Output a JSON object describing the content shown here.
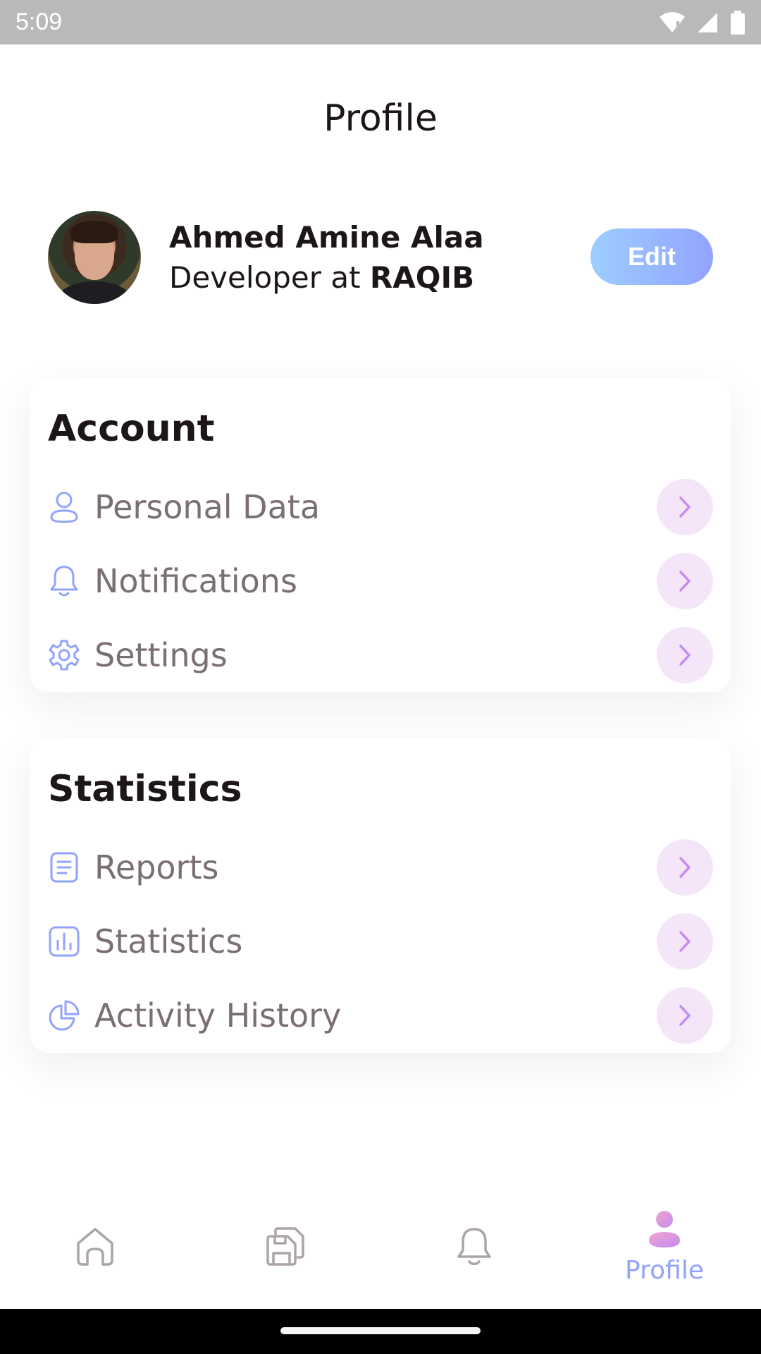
{
  "status_bar": {
    "time": "5:09"
  },
  "header": {
    "title": "Profile"
  },
  "profile": {
    "name": "Ahmed Amine Alaa",
    "role_prefix": "Developer at ",
    "company": "RAQIB",
    "edit_label": "Edit"
  },
  "account": {
    "title": "Account",
    "items": [
      {
        "label": "Personal Data",
        "icon": "profile-icon"
      },
      {
        "label": "Notifications",
        "icon": "bell-icon"
      },
      {
        "label": "Settings",
        "icon": "gear-icon"
      }
    ]
  },
  "statistics": {
    "title": "Statistics",
    "items": [
      {
        "label": "Reports",
        "icon": "document-icon"
      },
      {
        "label": "Statistics",
        "icon": "bar-chart-icon"
      },
      {
        "label": "Activity History",
        "icon": "pie-chart-icon"
      }
    ]
  },
  "bottom_nav": {
    "items": [
      {
        "icon": "home-icon"
      },
      {
        "icon": "save-icon"
      },
      {
        "icon": "bell-icon"
      },
      {
        "icon": "person-icon",
        "label": "Profile",
        "active": true
      }
    ]
  },
  "colors": {
    "accent_blue": "#92a3fd",
    "accent_light_blue": "#9dcefe",
    "accent_purple": "#c58bf2",
    "chevron_bg": "#f4e6f8",
    "text_dark": "#1d1617",
    "text_gray": "#7b6f72"
  }
}
